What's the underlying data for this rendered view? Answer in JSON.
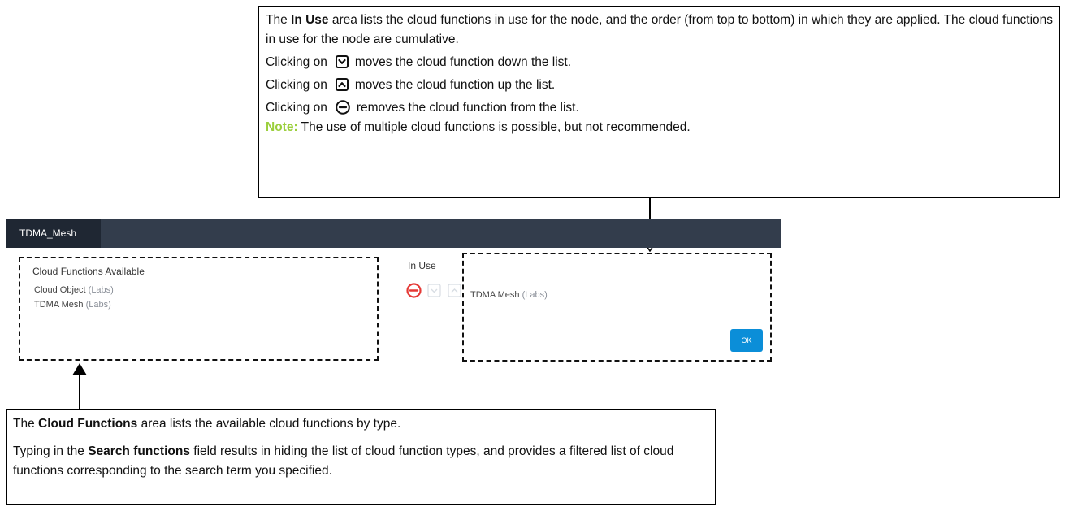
{
  "callout_top": {
    "line1_pre": "The ",
    "line1_bold": "In Use",
    "line1_post": " area lists the cloud functions in use for the node, and the order (from top to bottom) in which they are applied. The cloud functions in use for the node are cumulative.",
    "down_pre": "Clicking on",
    "down_post": "moves the cloud function down the list.",
    "up_pre": "Clicking on",
    "up_post": "moves the cloud function up the list.",
    "remove_pre": "Clicking on",
    "remove_post": "removes the cloud function from the list.",
    "note_label": "Note:",
    "note_text": " The use of multiple cloud functions is possible, but not recommended."
  },
  "callout_bottom": {
    "p1_pre": "The ",
    "p1_bold": "Cloud Functions",
    "p1_post": " area lists the available cloud functions by type.",
    "p2_pre": "Typing in the ",
    "p2_bold": "Search functions",
    "p2_post": " field results in hiding the list of cloud function types, and provides a filtered list of cloud functions corresponding to the search term you specified."
  },
  "dialog": {
    "tab_title": "TDMA_Mesh",
    "available_title": "Cloud Functions Available",
    "available": [
      {
        "name": "Cloud Object",
        "tag": "(Labs)"
      },
      {
        "name": "TDMA Mesh",
        "tag": "(Labs)"
      }
    ],
    "in_use_title": "In Use",
    "in_use": [
      {
        "name": "TDMA Mesh",
        "tag": "(Labs)"
      }
    ],
    "ok_label": "OK"
  },
  "colors": {
    "note": "#9bcf3c",
    "header_bar": "#333d4c",
    "tab": "#1f2733",
    "remove_icon": "#e53935",
    "ok_button": "#0b8ed8"
  },
  "icons": [
    "chevron-down-box-icon",
    "chevron-up-box-icon",
    "minus-circle-icon"
  ]
}
